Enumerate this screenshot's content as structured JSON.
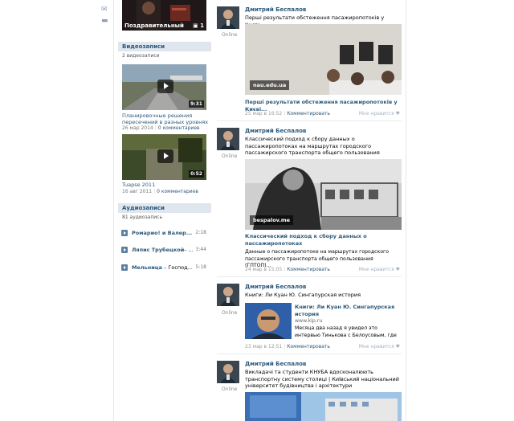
{
  "left_icons": [
    "mail-icon",
    "comment-icon"
  ],
  "top_album": {
    "caption": "Поздравительный",
    "count": "1"
  },
  "videos": {
    "header": "Видеозаписи",
    "count": "2 видеозаписи",
    "items": [
      {
        "title": "Планировочные решения пересечений в разных уровнях",
        "duration": "9:31",
        "date": "26 мар 2014",
        "comments": "0 комментариев"
      },
      {
        "title": "Tuapse 2011",
        "duration": "0:52",
        "date": "16 авг 2011",
        "comments": "0 комментариев"
      }
    ]
  },
  "audio": {
    "header": "Аудиозаписи",
    "count": "81 аудиозапись",
    "items": [
      {
        "artist": "Ромарио! и Валер...",
        "title": "",
        "duration": "2:18"
      },
      {
        "artist": "Ляпис Трубецкой",
        "title": "– ...",
        "duration": "3:44"
      },
      {
        "artist": "Мельница",
        "title": " – Господ...",
        "duration": "5:18"
      }
    ]
  },
  "posts": [
    {
      "author": "Дмитрий Беспалов",
      "status": "Online",
      "text": "Перші результати обстеження пасажиропотоків у Києві",
      "site": "nau.edu.ua",
      "link_title": "Перші результати обстеження пасажиропотоків у Києві...",
      "link_desc": "",
      "date": "25 мар в 16:52",
      "comment": "Комментировать",
      "like": "Мне нравится"
    },
    {
      "author": "Дмитрий Беспалов",
      "status": "Online",
      "text": "Классический подход к сбору данных о пассажиропотоках на маршрутах городского пассажирского транспорта общего пользования",
      "site": "bespalov.me",
      "link_title": "Классический подход к сбору данных о пассажиропотоках",
      "link_desc": "Данные о пассажиропотоке на маршрутах городского пассажирского транспорта общего пользования (ГПТОП)...",
      "date": "24 мар в 15:05",
      "comment": "Комментировать",
      "like": "Мне нравится"
    },
    {
      "author": "Дмитрий Беспалов",
      "status": "Online",
      "text": "Книги: Ли Куан Ю. Сингапурская история",
      "link_title": "Книги: Ли Куан Ю. Сингапурская история",
      "link_site": "www.kip.ru",
      "link_desc": "Месяца два назад я увидел это интервью Тинькова с Белоусовым, где упомянут",
      "date": "23 мар в 12:51",
      "comment": "Комментировать",
      "like": "Мне нравится"
    },
    {
      "author": "Дмитрий Беспалов",
      "status": "Online",
      "text": "Викладачі та студенти КНУБА вдосконалюють транспортну систему столиці | Київський національний університет будівництва і архітектури"
    }
  ]
}
